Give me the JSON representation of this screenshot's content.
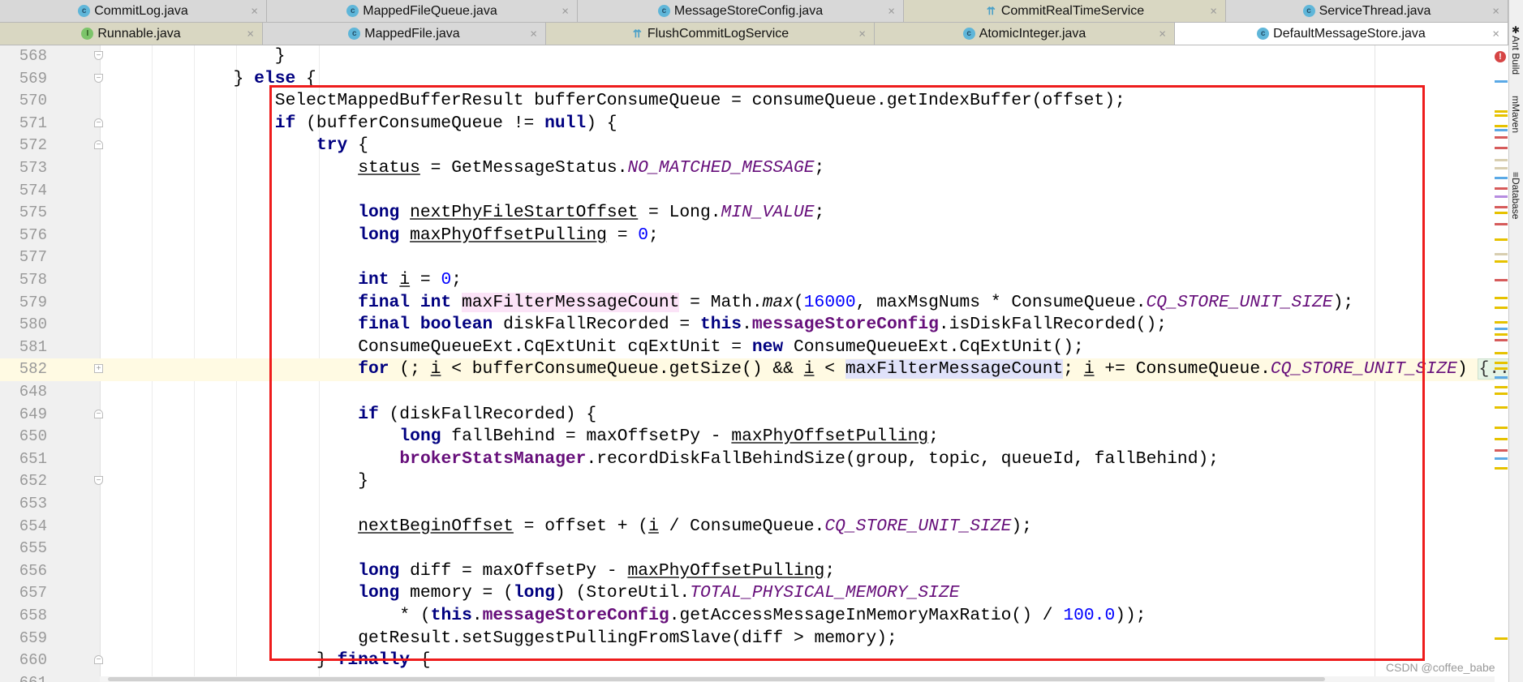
{
  "tabs_row1": [
    {
      "label": "CommitLog.java",
      "icon": "class-icon",
      "style": "gray"
    },
    {
      "label": "MappedFileQueue.java",
      "icon": "class-icon",
      "style": "gray"
    },
    {
      "label": "MessageStoreConfig.java",
      "icon": "class-icon",
      "style": "gray"
    },
    {
      "label": "CommitRealTimeService",
      "icon": "thread-class-icon",
      "style": "tan"
    },
    {
      "label": "ServiceThread.java",
      "icon": "abstract-class-icon",
      "style": "gray"
    }
  ],
  "tabs_row2": [
    {
      "label": "Runnable.java",
      "icon": "interface-icon",
      "style": "tan"
    },
    {
      "label": "MappedFile.java",
      "icon": "class-icon",
      "style": "gray"
    },
    {
      "label": "FlushCommitLogService",
      "icon": "thread-class-icon",
      "style": "tan"
    },
    {
      "label": "AtomicInteger.java",
      "icon": "class-icon",
      "style": "tan"
    },
    {
      "label": "DefaultMessageStore.java",
      "icon": "class-icon",
      "style": "active"
    }
  ],
  "tab_close_glyph": "×",
  "tool_windows": [
    {
      "label": "Ant Build",
      "icon": "ant-icon"
    },
    {
      "label": "Maven",
      "icon": "maven-icon"
    },
    {
      "label": "Database",
      "icon": "database-icon"
    }
  ],
  "watermark": "CSDN @coffee_babe",
  "colors": {
    "keyword": "#000080",
    "number": "#0000ff",
    "field": "#660e7a",
    "highlight_box": "#ee1c1c",
    "current_line": "#fffae3"
  },
  "code_lines": [
    {
      "n": "568",
      "indent": 16,
      "fold": "end",
      "tokens": [
        [
          "}",
          ""
        ]
      ]
    },
    {
      "n": "569",
      "indent": 12,
      "fold": "end",
      "tokens": [
        [
          "} ",
          ""
        ],
        [
          "else",
          "kw"
        ],
        [
          " {",
          ""
        ]
      ]
    },
    {
      "n": "570",
      "indent": 16,
      "tokens": [
        [
          "SelectMappedBufferResult bufferConsumeQueue = consumeQueue.getIndexBuffer(offset);",
          ""
        ]
      ]
    },
    {
      "n": "571",
      "indent": 16,
      "fold": "start",
      "tokens": [
        [
          "if",
          "kw"
        ],
        [
          " (bufferConsumeQueue != ",
          ""
        ],
        [
          "null",
          "kw"
        ],
        [
          ") {",
          ""
        ]
      ]
    },
    {
      "n": "572",
      "indent": 20,
      "fold": "start",
      "tokens": [
        [
          "try",
          "kw"
        ],
        [
          " {",
          ""
        ]
      ]
    },
    {
      "n": "573",
      "indent": 24,
      "tokens": [
        [
          "status",
          "u"
        ],
        [
          " = GetMessageStatus.",
          ""
        ],
        [
          "NO_MATCHED_MESSAGE",
          "sf"
        ],
        [
          ";",
          ""
        ]
      ]
    },
    {
      "n": "574",
      "indent": 0,
      "tokens": []
    },
    {
      "n": "575",
      "indent": 24,
      "tokens": [
        [
          "long",
          "kw"
        ],
        [
          " ",
          ""
        ],
        [
          "nextPhyFileStartOffset",
          "u"
        ],
        [
          " = Long.",
          ""
        ],
        [
          "MIN_VALUE",
          "sf"
        ],
        [
          ";",
          ""
        ]
      ]
    },
    {
      "n": "576",
      "indent": 24,
      "tokens": [
        [
          "long",
          "kw"
        ],
        [
          " ",
          ""
        ],
        [
          "maxPhyOffsetPulling",
          "u"
        ],
        [
          " = ",
          ""
        ],
        [
          "0",
          "num"
        ],
        [
          ";",
          ""
        ]
      ]
    },
    {
      "n": "577",
      "indent": 0,
      "tokens": []
    },
    {
      "n": "578",
      "indent": 24,
      "tokens": [
        [
          "int",
          "kw"
        ],
        [
          " ",
          ""
        ],
        [
          "i",
          "u"
        ],
        [
          " = ",
          ""
        ],
        [
          "0",
          "num"
        ],
        [
          ";",
          ""
        ]
      ]
    },
    {
      "n": "579",
      "indent": 24,
      "tokens": [
        [
          "final",
          "kw"
        ],
        [
          " ",
          ""
        ],
        [
          "int",
          "kw"
        ],
        [
          " ",
          ""
        ],
        [
          "maxFilterMessageCount",
          "hlpink"
        ],
        [
          " = Math.",
          ""
        ],
        [
          "max",
          "it"
        ],
        [
          "(",
          ""
        ],
        [
          "16000",
          "num"
        ],
        [
          ", maxMsgNums * ConsumeQueue.",
          ""
        ],
        [
          "CQ_STORE_UNIT_SIZE",
          "sf"
        ],
        [
          ");",
          ""
        ]
      ]
    },
    {
      "n": "580",
      "indent": 24,
      "tokens": [
        [
          "final",
          "kw"
        ],
        [
          " ",
          ""
        ],
        [
          "boolean",
          "kw"
        ],
        [
          " diskFallRecorded = ",
          ""
        ],
        [
          "this",
          "kw"
        ],
        [
          ".",
          ""
        ],
        [
          "messageStoreConfig",
          "fld"
        ],
        [
          ".isDiskFallRecorded();",
          ""
        ]
      ]
    },
    {
      "n": "581",
      "indent": 24,
      "tokens": [
        [
          "ConsumeQueueExt.CqExtUnit cqExtUnit = ",
          ""
        ],
        [
          "new",
          "kw"
        ],
        [
          " ConsumeQueueExt.CqExtUnit();",
          ""
        ]
      ]
    },
    {
      "n": "582",
      "indent": 24,
      "fold": "plus",
      "current": true,
      "tokens": [
        [
          "for",
          "kw"
        ],
        [
          " (; ",
          ""
        ],
        [
          "i",
          "u"
        ],
        [
          " < bufferConsumeQueue.getSize() && ",
          ""
        ],
        [
          "i",
          "u"
        ],
        [
          " < ",
          ""
        ],
        [
          "maxFilterMessageCount",
          "hlblue"
        ],
        [
          "; ",
          ""
        ],
        [
          "i",
          "u"
        ],
        [
          " += ConsumeQueue.",
          ""
        ],
        [
          "CQ_STORE_UNIT_SIZE",
          "sf"
        ],
        [
          ") ",
          ""
        ],
        [
          "{...}",
          "foldtxt"
        ]
      ]
    },
    {
      "n": "648",
      "indent": 0,
      "tokens": []
    },
    {
      "n": "649",
      "indent": 24,
      "fold": "start",
      "tokens": [
        [
          "if",
          "kw"
        ],
        [
          " (diskFallRecorded) {",
          ""
        ]
      ]
    },
    {
      "n": "650",
      "indent": 28,
      "tokens": [
        [
          "long",
          "kw"
        ],
        [
          " fallBehind = maxOffsetPy - ",
          ""
        ],
        [
          "maxPhyOffsetPulling",
          "u"
        ],
        [
          ";",
          ""
        ]
      ]
    },
    {
      "n": "651",
      "indent": 28,
      "tokens": [
        [
          "brokerStatsManager",
          "fld"
        ],
        [
          ".recordDiskFallBehindSize(group, topic, queueId, fallBehind);",
          ""
        ]
      ]
    },
    {
      "n": "652",
      "indent": 24,
      "fold": "end",
      "tokens": [
        [
          "}",
          ""
        ]
      ]
    },
    {
      "n": "653",
      "indent": 0,
      "tokens": []
    },
    {
      "n": "654",
      "indent": 24,
      "tokens": [
        [
          "nextBeginOffset",
          "u"
        ],
        [
          " = offset + (",
          ""
        ],
        [
          "i",
          "u"
        ],
        [
          " / ConsumeQueue.",
          ""
        ],
        [
          "CQ_STORE_UNIT_SIZE",
          "sf"
        ],
        [
          ");",
          ""
        ]
      ]
    },
    {
      "n": "655",
      "indent": 0,
      "tokens": []
    },
    {
      "n": "656",
      "indent": 24,
      "tokens": [
        [
          "long",
          "kw"
        ],
        [
          " diff = maxOffsetPy - ",
          ""
        ],
        [
          "maxPhyOffsetPulling",
          "u"
        ],
        [
          ";",
          ""
        ]
      ]
    },
    {
      "n": "657",
      "indent": 24,
      "tokens": [
        [
          "long",
          "kw"
        ],
        [
          " memory = (",
          ""
        ],
        [
          "long",
          "kw"
        ],
        [
          ") (StoreUtil.",
          ""
        ],
        [
          "TOTAL_PHYSICAL_MEMORY_SIZE",
          "sf"
        ]
      ]
    },
    {
      "n": "658",
      "indent": 28,
      "tokens": [
        [
          "* (",
          ""
        ],
        [
          "this",
          "kw"
        ],
        [
          ".",
          ""
        ],
        [
          "messageStoreConfig",
          "fld"
        ],
        [
          ".getAccessMessageInMemoryMaxRatio() / ",
          ""
        ],
        [
          "100.0",
          "num"
        ],
        [
          "));",
          ""
        ]
      ]
    },
    {
      "n": "659",
      "indent": 24,
      "tokens": [
        [
          "getResult.setSuggestPullingFromSlave(diff > memory);",
          ""
        ]
      ]
    },
    {
      "n": "660",
      "indent": 20,
      "fold": "start",
      "tokens": [
        [
          "} ",
          ""
        ],
        [
          "finally",
          "kw"
        ],
        [
          " {",
          ""
        ]
      ]
    },
    {
      "n": "661",
      "indent": 0,
      "tokens": []
    }
  ]
}
